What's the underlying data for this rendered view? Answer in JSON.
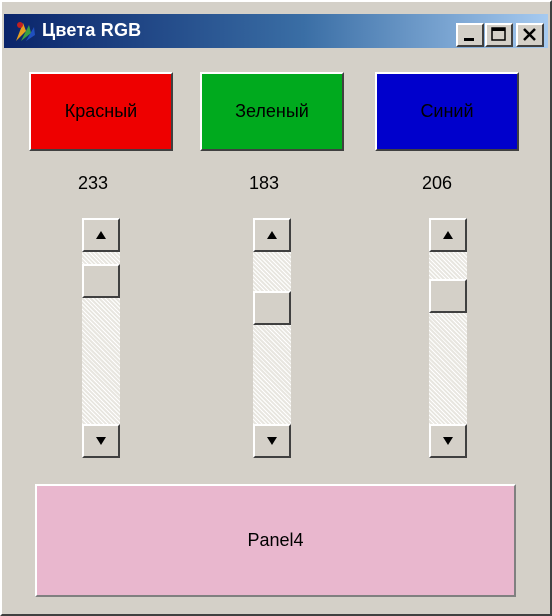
{
  "window": {
    "title": "Цвета RGB",
    "icon": "app-icon",
    "controls": {
      "minimize": "minimize-icon",
      "maximize": "maximize-icon",
      "close": "close-icon"
    }
  },
  "buttons": [
    {
      "label": "Красный",
      "color": "#ee0000"
    },
    {
      "label": "Зеленый",
      "color": "#00aa1e"
    },
    {
      "label": "Синий",
      "color": "#0000cc"
    }
  ],
  "values": [
    "233",
    "183",
    "206"
  ],
  "scrollbars": [
    {
      "value": 233,
      "min": 0,
      "max": 255
    },
    {
      "value": 183,
      "min": 0,
      "max": 255
    },
    {
      "value": 206,
      "min": 0,
      "max": 255
    }
  ],
  "panel": {
    "caption": "Panel4",
    "color": "#e9b7ce"
  }
}
